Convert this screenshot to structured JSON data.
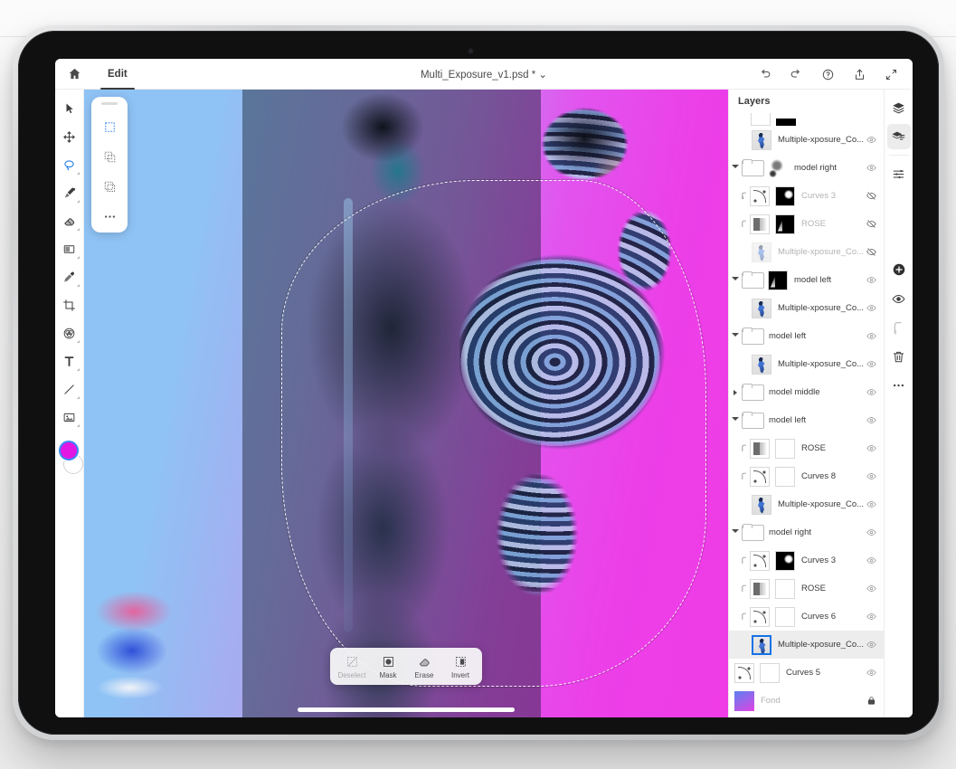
{
  "app": {
    "topbar": {
      "home_icon": "home-icon",
      "edit_tab": "Edit",
      "document_title": "Multi_Exposure_v1.psd * ⌄",
      "actions": [
        {
          "name": "undo-icon",
          "label": "Undo"
        },
        {
          "name": "redo-icon",
          "label": "Redo"
        },
        {
          "name": "help-icon",
          "label": "Help"
        },
        {
          "name": "share-icon",
          "label": "Share"
        },
        {
          "name": "expand-icon",
          "label": "Expand"
        }
      ]
    },
    "toolbar": {
      "tools": [
        {
          "name": "select-tool",
          "label": "Select"
        },
        {
          "name": "move-tool",
          "label": "Move"
        },
        {
          "name": "lasso-tool",
          "label": "Lasso",
          "selected": true
        },
        {
          "name": "brush-tool",
          "label": "Brush"
        },
        {
          "name": "eraser-tool",
          "label": "Eraser"
        },
        {
          "name": "gradient-tool",
          "label": "Gradient"
        },
        {
          "name": "heal-tool",
          "label": "Healing Brush"
        },
        {
          "name": "crop-tool",
          "label": "Crop"
        },
        {
          "name": "adjust-tool",
          "label": "Adjustments"
        },
        {
          "name": "text-tool",
          "label": "Text"
        },
        {
          "name": "line-tool",
          "label": "Line"
        },
        {
          "name": "place-image-tool",
          "label": "Place Image"
        }
      ],
      "foreground_color": "#e317e3",
      "background_color": "#ffffff"
    },
    "tool_options": {
      "handle": "drag-handle",
      "options": [
        {
          "name": "new-selection-option",
          "label": "New selection",
          "selected": true
        },
        {
          "name": "add-selection-option",
          "label": "Add to selection"
        },
        {
          "name": "subtract-selection-option",
          "label": "Subtract from selection"
        },
        {
          "name": "more-options",
          "label": "More"
        }
      ]
    },
    "context_bar": {
      "items": [
        {
          "name": "deselect-action",
          "label": "Deselect",
          "icon": "deselect-icon",
          "disabled": true
        },
        {
          "name": "mask-action",
          "label": "Mask",
          "icon": "mask-icon",
          "disabled": false
        },
        {
          "name": "erase-action",
          "label": "Erase",
          "icon": "erase-icon",
          "disabled": false
        },
        {
          "name": "invert-action",
          "label": "Invert",
          "icon": "invert-icon",
          "disabled": false
        }
      ]
    },
    "layers_panel": {
      "title": "Layers",
      "rows": [
        {
          "name": "Multiple-xposure_Co...",
          "type": "image",
          "indent": 1,
          "visible": true,
          "selected": false,
          "clipped": false,
          "group": false
        },
        {
          "name": "model right",
          "type": "group",
          "indent": 0,
          "visible": true,
          "expanded": true,
          "mask": "blur",
          "group": true
        },
        {
          "name": "Curves 3",
          "type": "curves",
          "indent": 2,
          "visible": false,
          "clipped": true,
          "mask": "blob"
        },
        {
          "name": "ROSE",
          "type": "rose",
          "indent": 2,
          "visible": false,
          "clipped": true,
          "mask": "corner"
        },
        {
          "name": "Multiple-xposure_Co...",
          "type": "image",
          "indent": 1,
          "visible": false,
          "clipped": false
        },
        {
          "name": "model left",
          "type": "group",
          "indent": 0,
          "visible": true,
          "expanded": true,
          "mask": "corner",
          "group": true
        },
        {
          "name": "Multiple-xposure_Co...",
          "type": "image",
          "indent": 1,
          "visible": true,
          "clipped": false
        },
        {
          "name": "model left",
          "type": "group",
          "indent": 0,
          "visible": true,
          "expanded": true,
          "group": true
        },
        {
          "name": "Multiple-xposure_Co...",
          "type": "image",
          "indent": 1,
          "visible": true,
          "clipped": false
        },
        {
          "name": "model middle",
          "type": "group",
          "indent": 0,
          "visible": true,
          "expanded": false,
          "group": true
        },
        {
          "name": "model left",
          "type": "group",
          "indent": 0,
          "visible": true,
          "expanded": true,
          "group": true
        },
        {
          "name": "ROSE",
          "type": "rose",
          "indent": 2,
          "visible": true,
          "clipped": true,
          "mask": "white"
        },
        {
          "name": "Curves 8",
          "type": "curves",
          "indent": 2,
          "visible": true,
          "clipped": true,
          "mask": "white"
        },
        {
          "name": "Multiple-xposure_Co...",
          "type": "image",
          "indent": 1,
          "visible": true,
          "clipped": false
        },
        {
          "name": "model right",
          "type": "group",
          "indent": 0,
          "visible": true,
          "expanded": true,
          "group": true
        },
        {
          "name": "Curves 3",
          "type": "curves",
          "indent": 2,
          "visible": true,
          "clipped": true,
          "mask": "blob"
        },
        {
          "name": "ROSE",
          "type": "rose",
          "indent": 2,
          "visible": true,
          "clipped": true,
          "mask": "white"
        },
        {
          "name": "Curves 6",
          "type": "curves",
          "indent": 2,
          "visible": true,
          "clipped": true,
          "mask": "white"
        },
        {
          "name": "Multiple-xposure_Co...",
          "type": "image",
          "indent": 1,
          "visible": true,
          "selected": true,
          "clipped": false
        },
        {
          "name": "Curves 5",
          "type": "curves",
          "indent": 0,
          "visible": true,
          "clipped": false,
          "mask": "white"
        },
        {
          "name": "Fond",
          "type": "fill",
          "indent": 0,
          "visible": true,
          "locked": true
        }
      ]
    },
    "right_rail": {
      "items": [
        {
          "name": "layers-stack-icon",
          "label": "Layers"
        },
        {
          "name": "layer-properties-icon",
          "label": "Layer properties",
          "selected": true
        },
        {
          "name": "adjustments-sliders-icon",
          "label": "Adjustments"
        },
        {
          "name": "add-layer-icon",
          "label": "Add layer"
        },
        {
          "name": "toggle-visibility-icon",
          "label": "Toggle visibility"
        },
        {
          "name": "clipping-mask-icon",
          "label": "Clipping mask",
          "disabled": true
        },
        {
          "name": "delete-layer-icon",
          "label": "Delete layer"
        },
        {
          "name": "more-layer-actions-icon",
          "label": "More"
        }
      ]
    },
    "canvas": {
      "gradient_left": "#8fc3f5",
      "gradient_mid": "#b87aee",
      "gradient_right": "#ef3ce6",
      "selection_active": true
    }
  }
}
